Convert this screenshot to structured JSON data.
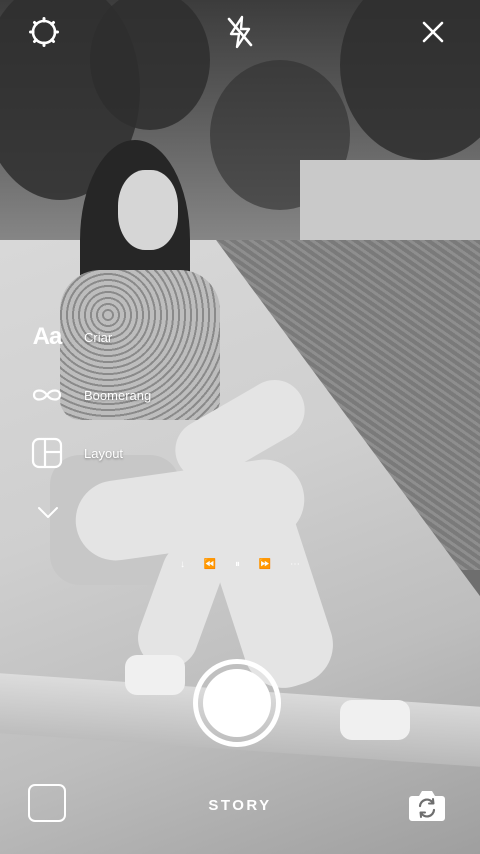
{
  "top_bar": {
    "settings_icon": "gear-icon",
    "flash_icon": "flash-off-icon",
    "close_icon": "close-icon"
  },
  "tools": [
    {
      "icon": "text-aa-icon",
      "icon_text": "Aa",
      "label": "Criar"
    },
    {
      "icon": "infinity-icon",
      "label": "Boomerang"
    },
    {
      "icon": "layout-grid-icon",
      "label": "Layout"
    }
  ],
  "more_icon": "chevron-down-icon",
  "media_controls": {
    "glyphs": [
      "↓",
      "⏪",
      "⏸",
      "⏩",
      "⋯"
    ]
  },
  "bottom_bar": {
    "mode_label": "STORY",
    "gallery_icon": "gallery-thumbnail",
    "flip_icon": "flip-camera-icon"
  }
}
